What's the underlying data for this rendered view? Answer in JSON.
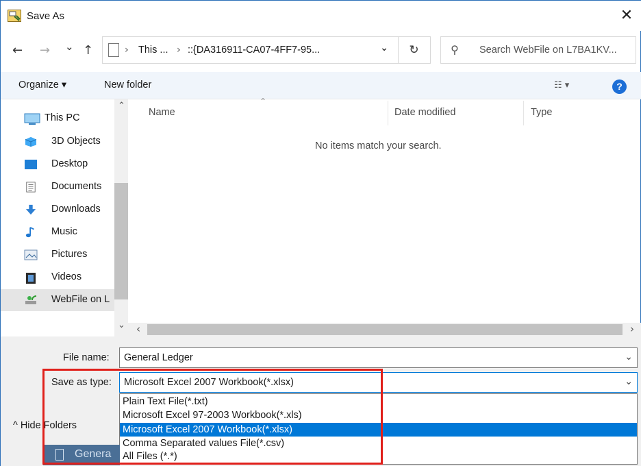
{
  "window": {
    "title": "Save As",
    "close_glyph": "✕"
  },
  "nav": {
    "back_glyph": "←",
    "forward_glyph": "→",
    "recent_glyph": "⌄",
    "up_glyph": "↑",
    "breadcrumb": [
      "This ...",
      "::{DA316911-CA07-4FF7-95..."
    ],
    "crumb_sep": "›",
    "address_dropdown_glyph": "⌄",
    "refresh_glyph": "↻",
    "search_placeholder": "Search WebFile on L7BA1KV..."
  },
  "toolbar": {
    "organize_label": "Organize ▾",
    "new_folder_label": "New folder",
    "view_glyph": "☷ ▾",
    "help_glyph": "?"
  },
  "sidebar": {
    "items": [
      {
        "label": "This PC",
        "icon": "monitor-icon"
      },
      {
        "label": "3D Objects",
        "icon": "cube-icon"
      },
      {
        "label": "Desktop",
        "icon": "desktop-icon"
      },
      {
        "label": "Documents",
        "icon": "document-icon"
      },
      {
        "label": "Downloads",
        "icon": "download-arrow-icon"
      },
      {
        "label": "Music",
        "icon": "music-note-icon"
      },
      {
        "label": "Pictures",
        "icon": "picture-icon"
      },
      {
        "label": "Videos",
        "icon": "film-icon"
      },
      {
        "label": "WebFile on L",
        "icon": "network-drive-icon"
      }
    ],
    "scroll_up_glyph": "⌃",
    "scroll_down_glyph": "⌄"
  },
  "file_list": {
    "columns": [
      "Name",
      "Date modified",
      "Type"
    ],
    "sort_glyph": "⌃",
    "empty_message": "No items match your search.",
    "scroll_left_glyph": "‹",
    "scroll_right_glyph": "›"
  },
  "form": {
    "file_name_label": "File name:",
    "file_name_value": "General Ledger",
    "save_type_label": "Save as type:",
    "save_type_value": "Microsoft Excel 2007 Workbook(*.xlsx)",
    "dropdown_glyph": "⌄",
    "type_options": [
      "Plain Text File(*.txt)",
      "Microsoft Excel 97-2003 Workbook(*.xls)",
      "Microsoft Excel 2007 Workbook(*.xlsx)",
      "Comma Separated values File(*.csv)",
      "All Files (*.*)"
    ],
    "selected_option_index": 2,
    "hide_folders_label": "^ Hide Folders"
  },
  "taskbar": {
    "label": "Genera"
  },
  "colors": {
    "accent": "#0078d7",
    "highlight_box": "#e0201b",
    "help_icon": "#1c6ed6"
  }
}
